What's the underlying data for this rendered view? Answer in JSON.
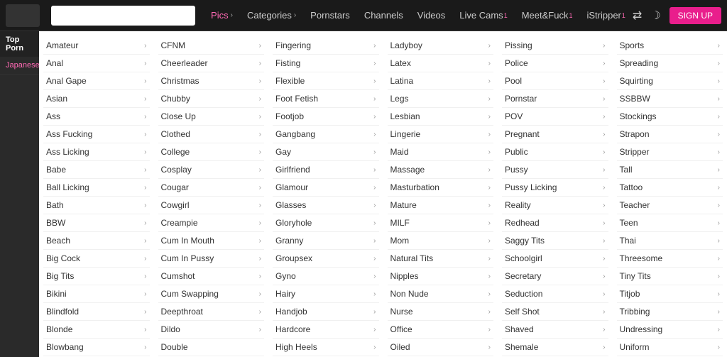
{
  "navbar": {
    "items": [
      {
        "label": "Pics",
        "arrow": true,
        "active": true
      },
      {
        "label": "Categories",
        "arrow": true,
        "active": false
      },
      {
        "label": "Pornstars",
        "arrow": false,
        "active": false
      },
      {
        "label": "Channels",
        "arrow": false,
        "active": false
      },
      {
        "label": "Videos",
        "arrow": false,
        "active": false
      },
      {
        "label": "Live Cams",
        "arrow": false,
        "active": false,
        "superscript": "1"
      },
      {
        "label": "Meet&Fuck",
        "arrow": false,
        "active": false,
        "superscript": "1"
      },
      {
        "label": "iStripper",
        "arrow": false,
        "active": false,
        "superscript": "1"
      }
    ],
    "signup_label": "SIGN UP",
    "icons": [
      "shuffle",
      "moon"
    ]
  },
  "sidebar": {
    "top_label": "Top Porn",
    "items": [
      {
        "label": "Japanese"
      }
    ]
  },
  "categories": {
    "columns": [
      {
        "items": [
          {
            "label": "Amateur",
            "has_arrow": true
          },
          {
            "label": "Anal",
            "has_arrow": true
          },
          {
            "label": "Anal Gape",
            "has_arrow": true
          },
          {
            "label": "Asian",
            "has_arrow": true
          },
          {
            "label": "Ass",
            "has_arrow": true
          },
          {
            "label": "Ass Fucking",
            "has_arrow": true
          },
          {
            "label": "Ass Licking",
            "has_arrow": true
          },
          {
            "label": "Babe",
            "has_arrow": true
          },
          {
            "label": "Ball Licking",
            "has_arrow": true
          },
          {
            "label": "Bath",
            "has_arrow": true
          },
          {
            "label": "BBW",
            "has_arrow": true
          },
          {
            "label": "Beach",
            "has_arrow": true
          },
          {
            "label": "Big Cock",
            "has_arrow": true
          },
          {
            "label": "Big Tits",
            "has_arrow": true
          },
          {
            "label": "Bikini",
            "has_arrow": true
          },
          {
            "label": "Blindfold",
            "has_arrow": true
          },
          {
            "label": "Blonde",
            "has_arrow": true
          },
          {
            "label": "Blowbang",
            "has_arrow": true
          }
        ]
      },
      {
        "items": [
          {
            "label": "CFNM",
            "has_arrow": true
          },
          {
            "label": "Cheerleader",
            "has_arrow": true
          },
          {
            "label": "Christmas",
            "has_arrow": true
          },
          {
            "label": "Chubby",
            "has_arrow": true
          },
          {
            "label": "Close Up",
            "has_arrow": true
          },
          {
            "label": "Clothed",
            "has_arrow": true
          },
          {
            "label": "College",
            "has_arrow": true
          },
          {
            "label": "Cosplay",
            "has_arrow": true
          },
          {
            "label": "Cougar",
            "has_arrow": true
          },
          {
            "label": "Cowgirl",
            "has_arrow": true
          },
          {
            "label": "Creampie",
            "has_arrow": true
          },
          {
            "label": "Cum In Mouth",
            "has_arrow": true
          },
          {
            "label": "Cum In Pussy",
            "has_arrow": true
          },
          {
            "label": "Cumshot",
            "has_arrow": true
          },
          {
            "label": "Cum Swapping",
            "has_arrow": true
          },
          {
            "label": "Deepthroat",
            "has_arrow": true
          },
          {
            "label": "Dildo",
            "has_arrow": true
          },
          {
            "label": "Double",
            "has_arrow": false
          }
        ]
      },
      {
        "items": [
          {
            "label": "Fingering",
            "has_arrow": true
          },
          {
            "label": "Fisting",
            "has_arrow": true
          },
          {
            "label": "Flexible",
            "has_arrow": true
          },
          {
            "label": "Foot Fetish",
            "has_arrow": true
          },
          {
            "label": "Footjob",
            "has_arrow": true
          },
          {
            "label": "Gangbang",
            "has_arrow": true
          },
          {
            "label": "Gay",
            "has_arrow": true
          },
          {
            "label": "Girlfriend",
            "has_arrow": true
          },
          {
            "label": "Glamour",
            "has_arrow": true
          },
          {
            "label": "Glasses",
            "has_arrow": true
          },
          {
            "label": "Gloryhole",
            "has_arrow": true
          },
          {
            "label": "Granny",
            "has_arrow": true
          },
          {
            "label": "Groupsex",
            "has_arrow": true
          },
          {
            "label": "Gyno",
            "has_arrow": true
          },
          {
            "label": "Hairy",
            "has_arrow": true
          },
          {
            "label": "Handjob",
            "has_arrow": true
          },
          {
            "label": "Hardcore",
            "has_arrow": true
          },
          {
            "label": "High Heels",
            "has_arrow": true
          }
        ]
      },
      {
        "items": [
          {
            "label": "Ladyboy",
            "has_arrow": true
          },
          {
            "label": "Latex",
            "has_arrow": true
          },
          {
            "label": "Latina",
            "has_arrow": true
          },
          {
            "label": "Legs",
            "has_arrow": true
          },
          {
            "label": "Lesbian",
            "has_arrow": true
          },
          {
            "label": "Lingerie",
            "has_arrow": true
          },
          {
            "label": "Maid",
            "has_arrow": true
          },
          {
            "label": "Massage",
            "has_arrow": true
          },
          {
            "label": "Masturbation",
            "has_arrow": true
          },
          {
            "label": "Mature",
            "has_arrow": true
          },
          {
            "label": "MILF",
            "has_arrow": true
          },
          {
            "label": "Mom",
            "has_arrow": true
          },
          {
            "label": "Natural Tits",
            "has_arrow": true
          },
          {
            "label": "Nipples",
            "has_arrow": true
          },
          {
            "label": "Non Nude",
            "has_arrow": true
          },
          {
            "label": "Nurse",
            "has_arrow": true
          },
          {
            "label": "Office",
            "has_arrow": true
          },
          {
            "label": "Oiled",
            "has_arrow": true
          }
        ]
      },
      {
        "items": [
          {
            "label": "Pissing",
            "has_arrow": true
          },
          {
            "label": "Police",
            "has_arrow": true
          },
          {
            "label": "Pool",
            "has_arrow": true
          },
          {
            "label": "Pornstar",
            "has_arrow": true
          },
          {
            "label": "POV",
            "has_arrow": true
          },
          {
            "label": "Pregnant",
            "has_arrow": true
          },
          {
            "label": "Public",
            "has_arrow": true
          },
          {
            "label": "Pussy",
            "has_arrow": true
          },
          {
            "label": "Pussy Licking",
            "has_arrow": true
          },
          {
            "label": "Reality",
            "has_arrow": true
          },
          {
            "label": "Redhead",
            "has_arrow": true
          },
          {
            "label": "Saggy Tits",
            "has_arrow": true
          },
          {
            "label": "Schoolgirl",
            "has_arrow": true
          },
          {
            "label": "Secretary",
            "has_arrow": true
          },
          {
            "label": "Seduction",
            "has_arrow": true
          },
          {
            "label": "Self Shot",
            "has_arrow": true
          },
          {
            "label": "Shaved",
            "has_arrow": true
          },
          {
            "label": "Shemale",
            "has_arrow": true
          }
        ]
      },
      {
        "items": [
          {
            "label": "Sports",
            "has_arrow": true
          },
          {
            "label": "Spreading",
            "has_arrow": true
          },
          {
            "label": "Squirting",
            "has_arrow": true
          },
          {
            "label": "SSBBW",
            "has_arrow": true
          },
          {
            "label": "Stockings",
            "has_arrow": true
          },
          {
            "label": "Strapon",
            "has_arrow": true
          },
          {
            "label": "Stripper",
            "has_arrow": true
          },
          {
            "label": "Tall",
            "has_arrow": true
          },
          {
            "label": "Tattoo",
            "has_arrow": true
          },
          {
            "label": "Teacher",
            "has_arrow": true
          },
          {
            "label": "Teen",
            "has_arrow": true
          },
          {
            "label": "Thai",
            "has_arrow": true
          },
          {
            "label": "Threesome",
            "has_arrow": true
          },
          {
            "label": "Tiny Tits",
            "has_arrow": true
          },
          {
            "label": "Titjob",
            "has_arrow": true
          },
          {
            "label": "Tribbing",
            "has_arrow": true
          },
          {
            "label": "Undressing",
            "has_arrow": true
          },
          {
            "label": "Uniform",
            "has_arrow": true
          }
        ]
      }
    ]
  }
}
